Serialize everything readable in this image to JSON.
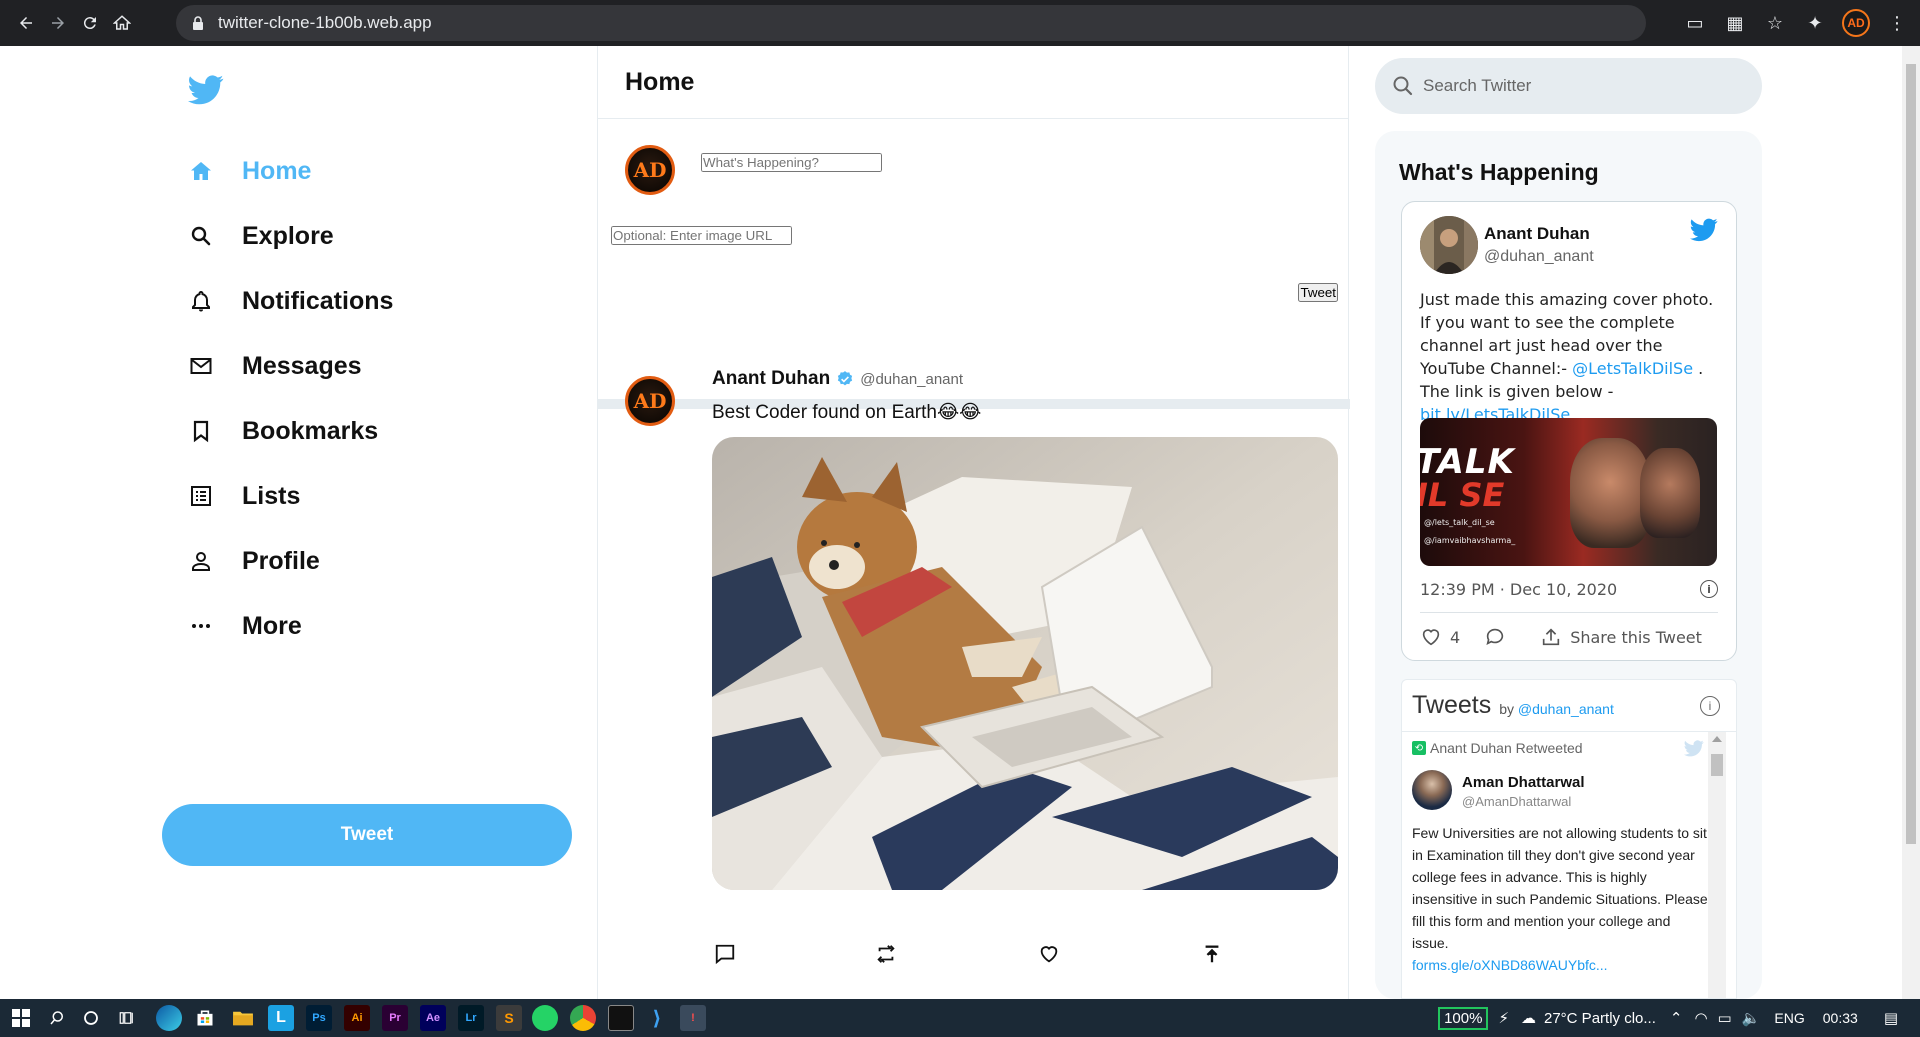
{
  "browser": {
    "url": "twitter-clone-1b00b.web.app",
    "avatar_text": "AD"
  },
  "sidebar": {
    "items": [
      {
        "label": "Home",
        "icon": "home-icon",
        "active": true
      },
      {
        "label": "Explore",
        "icon": "search-icon"
      },
      {
        "label": "Notifications",
        "icon": "bell-icon"
      },
      {
        "label": "Messages",
        "icon": "mail-icon"
      },
      {
        "label": "Bookmarks",
        "icon": "bookmark-icon"
      },
      {
        "label": "Lists",
        "icon": "list-icon"
      },
      {
        "label": "Profile",
        "icon": "person-icon"
      },
      {
        "label": "More",
        "icon": "more-icon"
      }
    ],
    "tweet_button": "Tweet"
  },
  "feed": {
    "title": "Home",
    "composer": {
      "avatar_text": "AD",
      "placeholder": "What's Happening?",
      "image_placeholder": "Optional: Enter image URL",
      "tweet_button": "Tweet"
    },
    "post": {
      "avatar_text": "AD",
      "name": "Anant Duhan",
      "handle": "@duhan_anant",
      "text": "Best Coder found on Earth😂😂"
    }
  },
  "widgets": {
    "search_placeholder": "Search Twitter",
    "title": "What's Happening",
    "embed": {
      "name": "Anant Duhan",
      "handle": "@duhan_anant",
      "text_1": "Just made this amazing cover photo. If you want to see the complete channel art just head over the YouTube Channel:- ",
      "mention": "@LetsTalkDilSe",
      "text_2": " . The link is given below - ",
      "link": "bit.ly/LetsTalkDilSe",
      "image_title_1": "TALK",
      "image_title_2": "IL SE",
      "image_sub_1": "@/lets_talk_dil_se",
      "image_sub_2": "@/iamvaibhavsharma_",
      "time": "12:39 PM · Dec 10, 2020",
      "likes": "4",
      "share": "Share this Tweet"
    },
    "timeline": {
      "title": "Tweets",
      "by": "by",
      "by_handle": "@duhan_anant",
      "retweeted": "Anant Duhan Retweeted",
      "name": "Aman Dhattarwal",
      "handle": "@AmanDhattarwal",
      "text": "Few Universities are not allowing students to sit in Examination till they don't give second year college fees in advance. This is highly insensitive in such Pandemic Situations. Please fill this form and mention your college and issue.",
      "link": "forms.gle/oXNBD86WAUYbfc..."
    }
  },
  "taskbar": {
    "battery": "100%",
    "weather": "27°C  Partly clo...",
    "language": "ENG",
    "time": "00:33"
  },
  "colors": {
    "accent": "#50b7f5",
    "link": "#1d9bf0"
  }
}
